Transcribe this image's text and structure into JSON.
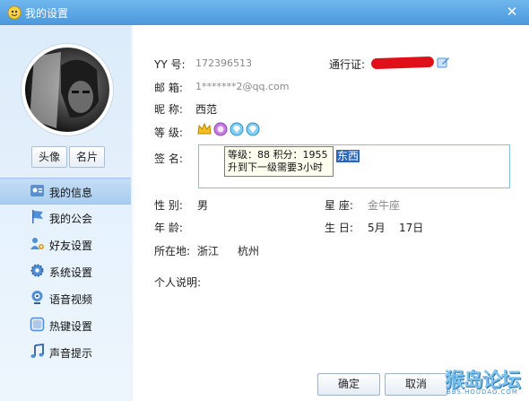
{
  "window": {
    "title": "我的设置",
    "close_glyph": "✕"
  },
  "profile": {
    "avatar_btn": "头像",
    "card_btn": "名片"
  },
  "sidebar": {
    "items": [
      {
        "label": "我的信息",
        "icon": "id-card-icon",
        "active": true
      },
      {
        "label": "我的公会",
        "icon": "flag-icon"
      },
      {
        "label": "好友设置",
        "icon": "friends-gear-icon"
      },
      {
        "label": "系统设置",
        "icon": "gear-icon"
      },
      {
        "label": "语音视频",
        "icon": "webcam-icon"
      },
      {
        "label": "热键设置",
        "icon": "hotkey-icon"
      },
      {
        "label": "声音提示",
        "icon": "music-note-icon"
      }
    ]
  },
  "info": {
    "yy_label": "YY 号:",
    "yy_value": "172396513",
    "pass_label": "通行证:",
    "email_label": "邮  箱:",
    "email_value": "1*******2@qq.com",
    "nick_label": "昵  称:",
    "nick_value": "西范",
    "level_label": "等  级:",
    "sig_label": "签  名:",
    "sig_selected": "东西",
    "tooltip_line1": "等级：88 积分：1955",
    "tooltip_line2": "升到下一级需要3小时",
    "gender_label": "性  别:",
    "gender_value": "男",
    "zodiac_label": "星  座:",
    "zodiac_value": "金牛座",
    "age_label": "年  龄:",
    "birthday_label": "生  日:",
    "birthday_month": "5月",
    "birthday_day": "17日",
    "location_label": "所在地:",
    "province": "浙江",
    "city": "杭州",
    "bio_label": "个人说明:"
  },
  "footer": {
    "ok": "确定",
    "cancel": "取消"
  },
  "watermark": {
    "text": "猴岛论坛",
    "sub": "BBS.HOUDAO.COM"
  },
  "colors": {
    "titlebar": "#4b97dc",
    "accent": "#2f64b8",
    "redact": "#e0101a"
  }
}
